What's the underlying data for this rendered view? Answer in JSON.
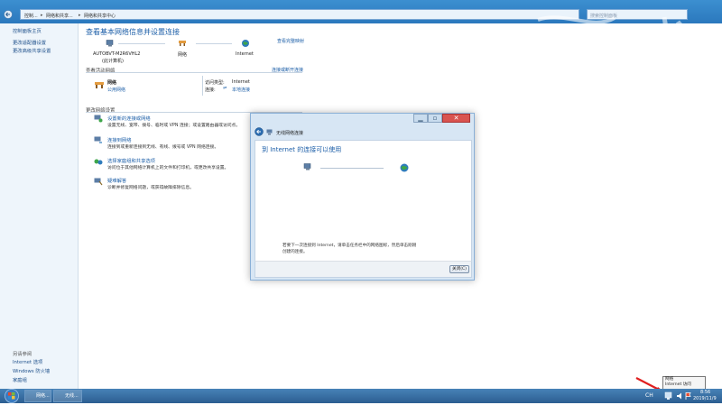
{
  "window": {
    "breadcrumb": [
      "控制...",
      "网络和共享...",
      "网络和共享中心"
    ],
    "search_placeholder": "搜索控制面板"
  },
  "leftnav": {
    "items": [
      "控制面板主页",
      "更改适配器设置",
      "更改高级共享设置"
    ],
    "see_also_header": "另请参阅",
    "see_also": [
      "Internet 选项",
      "Windows 防火墙",
      "家庭组"
    ]
  },
  "main": {
    "title": "查看基本网络信息并设置连接",
    "view_full_map": "查看完整映射",
    "map": {
      "computer": "AUTOBVT-M2R6VHL2",
      "computer_sub": "(此计算机)",
      "network": "网络",
      "internet": "Internet"
    },
    "active_header": "查看活动网络",
    "connect_disconnect": "连接或断开连接",
    "network_name": "网络",
    "network_type": "公用网络",
    "access_type_label": "访问类型:",
    "access_type_value": "Internet",
    "connections_label": "连接:",
    "connections_value": "本地连接",
    "change_header": "更改网络设置",
    "tasks": [
      {
        "title": "设置新的连接或网络",
        "desc": "设置无线、宽带、拨号、临时或 VPN 连接；或设置路由器或访问点。"
      },
      {
        "title": "连接到网络",
        "desc": "连接到或重新连接到无线、有线、拨号或 VPN 网络连接。"
      },
      {
        "title": "选择家庭组和共享选项",
        "desc": "访问位于其他网络计算机上的文件和打印机，或更改共享设置。"
      },
      {
        "title": "疑难解答",
        "desc": "诊断并修复网络问题，或获得故障排除信息。"
      }
    ]
  },
  "dialog": {
    "title": "无线网络连接",
    "heading": "到 Internet 的连接可以使用",
    "message": "若要下一次连接到 Internet，请单击任务栏中的网络图标，然后单击刚刚创建的连接。",
    "close_button": "关闭(C)"
  },
  "taskbar": {
    "tasks": [
      "网络...",
      "无线..."
    ],
    "time": "8:56",
    "date": "2019/11/9",
    "lang": "CH",
    "tooltip_line1": "网络",
    "tooltip_line2": "Internet 访问"
  },
  "colors": {
    "accent": "#1d5fa8",
    "arrow": "#e01f1f",
    "taskbar": "#2c5e91"
  }
}
